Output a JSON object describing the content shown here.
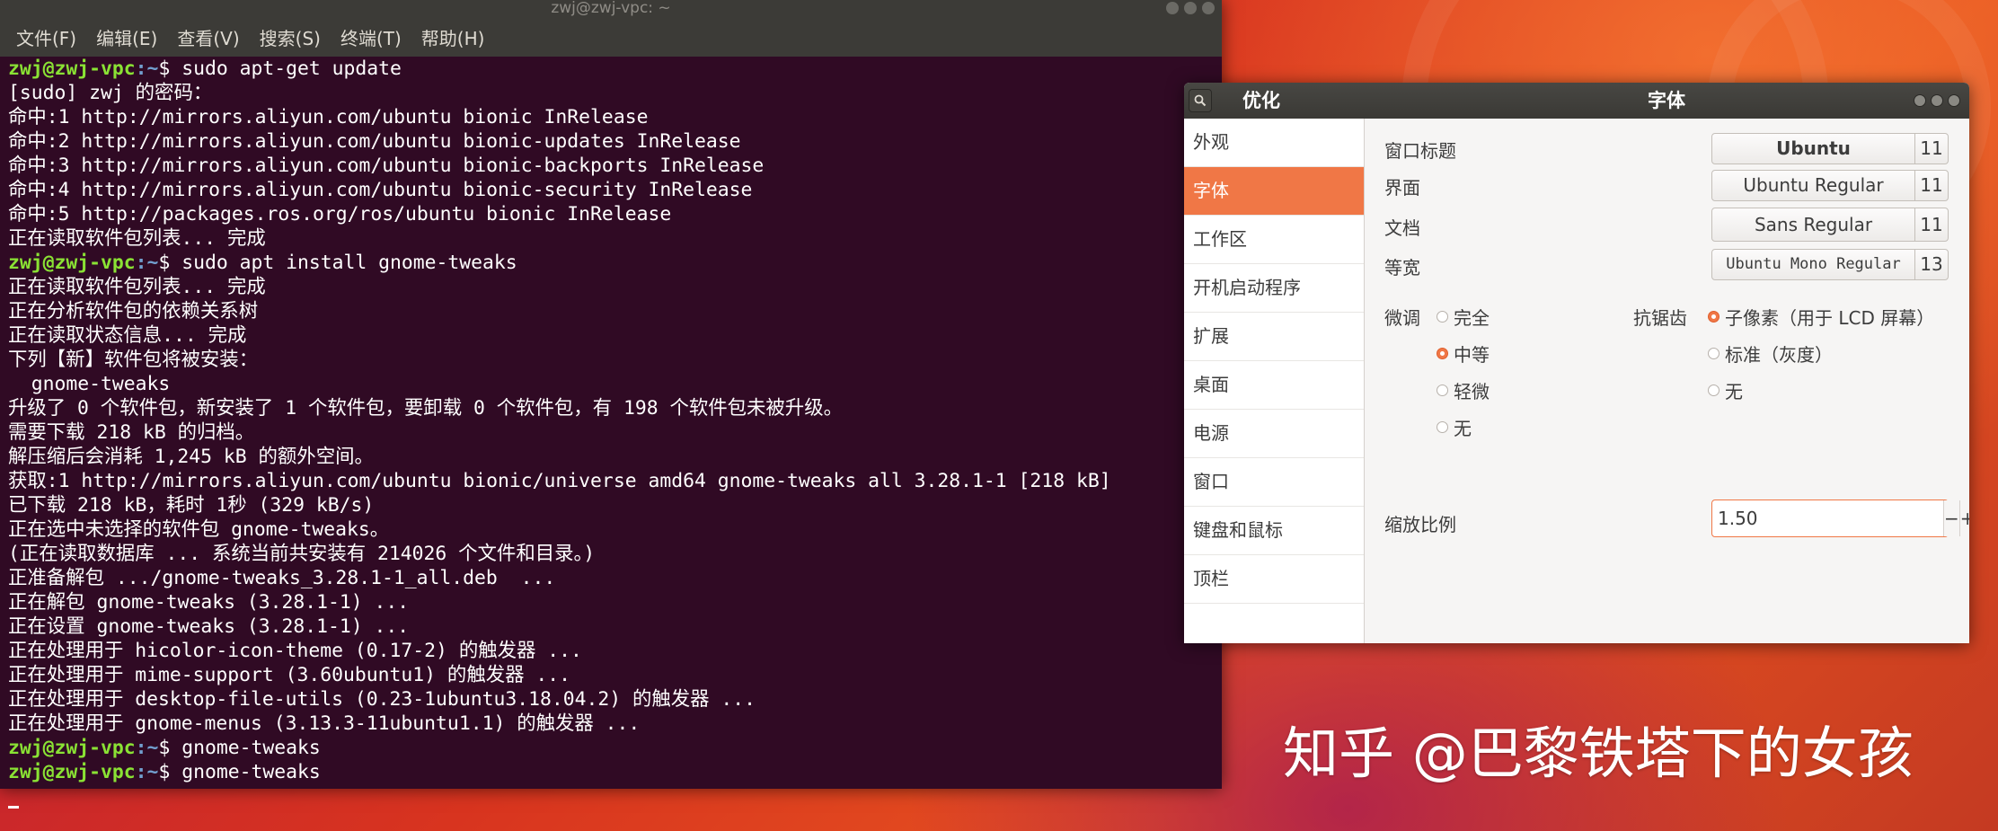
{
  "terminal": {
    "title": "zwj@zwj-vpc: ~",
    "menu": [
      "文件(F)",
      "编辑(E)",
      "查看(V)",
      "搜索(S)",
      "终端(T)",
      "帮助(H)"
    ],
    "prompt_user": "zwj@zwj-vpc",
    "prompt_path": ":~",
    "prompt_symbol": "$ ",
    "lines": [
      {
        "prompt": true,
        "text": "sudo apt-get update"
      },
      {
        "text": "[sudo] zwj 的密码："
      },
      {
        "text": "命中:1 http://mirrors.aliyun.com/ubuntu bionic InRelease"
      },
      {
        "text": "命中:2 http://mirrors.aliyun.com/ubuntu bionic-updates InRelease"
      },
      {
        "text": "命中:3 http://mirrors.aliyun.com/ubuntu bionic-backports InRelease"
      },
      {
        "text": "命中:4 http://mirrors.aliyun.com/ubuntu bionic-security InRelease"
      },
      {
        "text": "命中:5 http://packages.ros.org/ros/ubuntu bionic InRelease"
      },
      {
        "text": "正在读取软件包列表... 完成"
      },
      {
        "prompt": true,
        "text": "sudo apt install gnome-tweaks"
      },
      {
        "text": "正在读取软件包列表... 完成"
      },
      {
        "text": "正在分析软件包的依赖关系树"
      },
      {
        "text": "正在读取状态信息... 完成"
      },
      {
        "text": "下列【新】软件包将被安装："
      },
      {
        "text": "  gnome-tweaks"
      },
      {
        "text": "升级了 0 个软件包，新安装了 1 个软件包，要卸载 0 个软件包，有 198 个软件包未被升级。"
      },
      {
        "text": "需要下载 218 kB 的归档。"
      },
      {
        "text": "解压缩后会消耗 1,245 kB 的额外空间。"
      },
      {
        "text": "获取:1 http://mirrors.aliyun.com/ubuntu bionic/universe amd64 gnome-tweaks all 3.28.1-1 [218 kB]"
      },
      {
        "text": "已下载 218 kB，耗时 1秒 (329 kB/s)"
      },
      {
        "text": "正在选中未选择的软件包 gnome-tweaks。"
      },
      {
        "text": "(正在读取数据库 ... 系统当前共安装有 214026 个文件和目录。)"
      },
      {
        "text": "正准备解包 .../gnome-tweaks_3.28.1-1_all.deb  ..."
      },
      {
        "text": "正在解包 gnome-tweaks (3.28.1-1) ..."
      },
      {
        "text": "正在设置 gnome-tweaks (3.28.1-1) ..."
      },
      {
        "text": "正在处理用于 hicolor-icon-theme (0.17-2) 的触发器 ..."
      },
      {
        "text": "正在处理用于 mime-support (3.60ubuntu1) 的触发器 ..."
      },
      {
        "text": "正在处理用于 desktop-file-utils (0.23-1ubuntu3.18.04.2) 的触发器 ..."
      },
      {
        "text": "正在处理用于 gnome-menus (3.13.3-11ubuntu1.1) 的触发器 ..."
      },
      {
        "prompt": true,
        "text": "gnome-tweaks"
      },
      {
        "prompt": true,
        "text": "gnome-tweaks"
      }
    ]
  },
  "tweaks": {
    "sidebar_title": "优化",
    "page_title": "字体",
    "sidebar_items": [
      "外观",
      "字体",
      "工作区",
      "开机启动程序",
      "扩展",
      "桌面",
      "电源",
      "窗口",
      "键盘和鼠标",
      "顶栏"
    ],
    "active_index": 1,
    "fonts": {
      "window_title_label": "窗口标题",
      "window_title_font": "Ubuntu",
      "window_title_size": "11",
      "interface_label": "界面",
      "interface_font": "Ubuntu Regular",
      "interface_size": "11",
      "document_label": "文档",
      "document_font": "Sans Regular",
      "document_size": "11",
      "monospace_label": "等宽",
      "monospace_font": "Ubuntu Mono Regular",
      "monospace_size": "13"
    },
    "hinting": {
      "label": "微调",
      "options": [
        "完全",
        "中等",
        "轻微",
        "无"
      ],
      "selected": "中等"
    },
    "antialiasing": {
      "label": "抗锯齿",
      "options": [
        "子像素（用于 LCD 屏幕）",
        "标准（灰度）",
        "无"
      ],
      "selected": "子像素（用于 LCD 屏幕）"
    },
    "scaling": {
      "label": "缩放比例",
      "value": "1.50",
      "minus": "−",
      "plus": "+"
    }
  },
  "watermark": "知乎 @巴黎铁塔下的女孩",
  "colors": {
    "accent": "#f07746",
    "terminal_bg": "#300a24",
    "prompt_user": "#8ae234",
    "prompt_path": "#729fcf"
  }
}
